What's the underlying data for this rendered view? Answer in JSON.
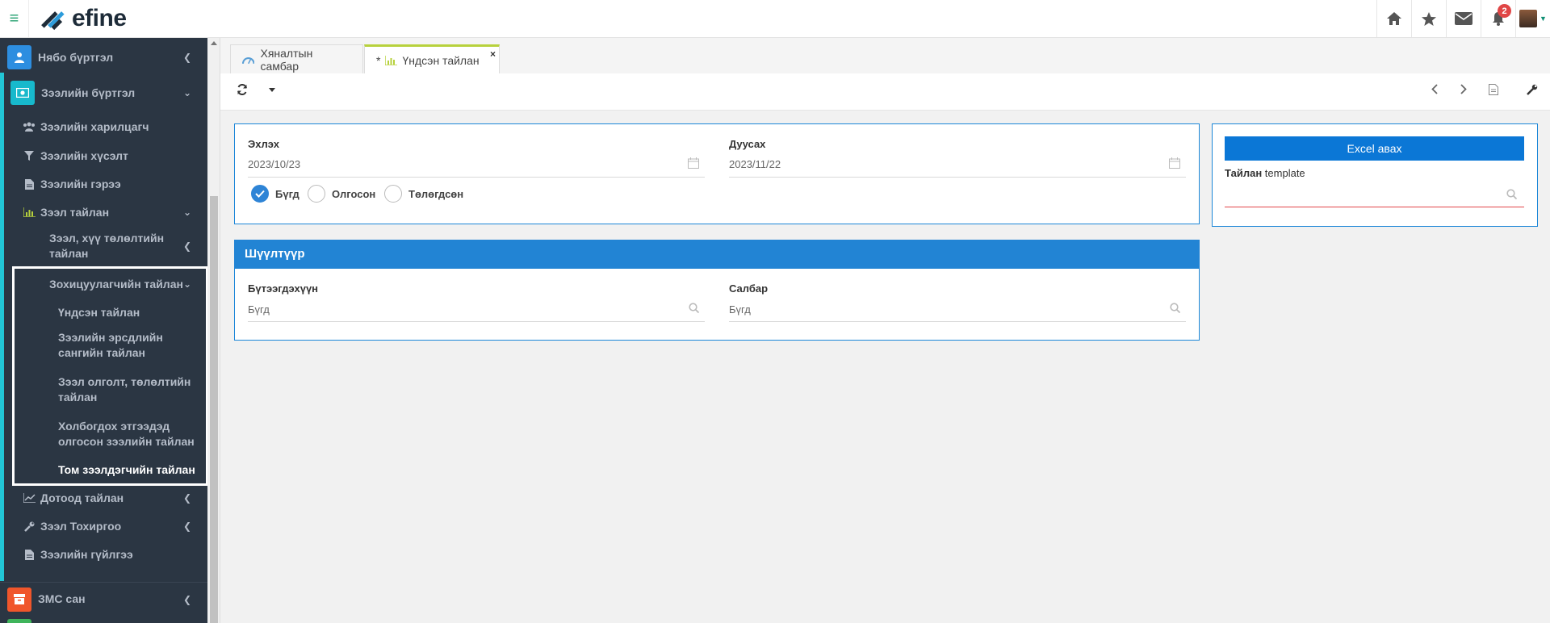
{
  "header": {
    "logo_text": "efine",
    "notification_count": "2"
  },
  "sidebar": {
    "items": [
      {
        "label": "Нябо бүртгэл"
      },
      {
        "label": "Зээлийн бүртгэл"
      },
      {
        "label": "Зээлийн харилцагч"
      },
      {
        "label": "Зээлийн хүсэлт"
      },
      {
        "label": "Зээлийн гэрээ"
      },
      {
        "label": "Зээл тайлан"
      },
      {
        "label": "Зээл, хүү төлөлтийн тайлан"
      },
      {
        "label": "Зохицуулагчийн тайлан"
      },
      {
        "label": "Үндсэн тайлан"
      },
      {
        "label": "Зээлийн эрсдлийн сангийн тайлан"
      },
      {
        "label": "Зээл олголт, төлөлтийн тайлан"
      },
      {
        "label": "Холбогдох этгээдэд олгосон зээлийн тайлан"
      },
      {
        "label": "Том зээлдэгчийн тайлан"
      },
      {
        "label": "Дотоод тайлан"
      },
      {
        "label": "Зээл Тохиргоо"
      },
      {
        "label": "Зээлийн гүйлгээ"
      },
      {
        "label": "ЗМС сан"
      }
    ]
  },
  "tabs": [
    {
      "label": "Хяналтын самбар"
    },
    {
      "label": "Үндсэн тайлан",
      "prefix": "*",
      "close": "×"
    }
  ],
  "form": {
    "start_label": "Эхлэх",
    "start_value": "2023/10/23",
    "end_label": "Дуусах",
    "end_value": "2023/11/22",
    "radios": [
      {
        "label": "Бүгд",
        "checked": true
      },
      {
        "label": "Олгосон",
        "checked": false
      },
      {
        "label": "Төлөгдсөн",
        "checked": false
      }
    ]
  },
  "right_panel": {
    "excel_button": "Excel авах",
    "template_label_bold": "Тайлан",
    "template_label_rest": " template"
  },
  "filter": {
    "title": "Шүүлтүүр",
    "product_label": "Бүтээгдэхүүн",
    "product_value": "Бүгд",
    "branch_label": "Салбар",
    "branch_value": "Бүгд"
  },
  "colors": {
    "accent": "#2284d4",
    "sidebar_bg": "#2b3643"
  }
}
